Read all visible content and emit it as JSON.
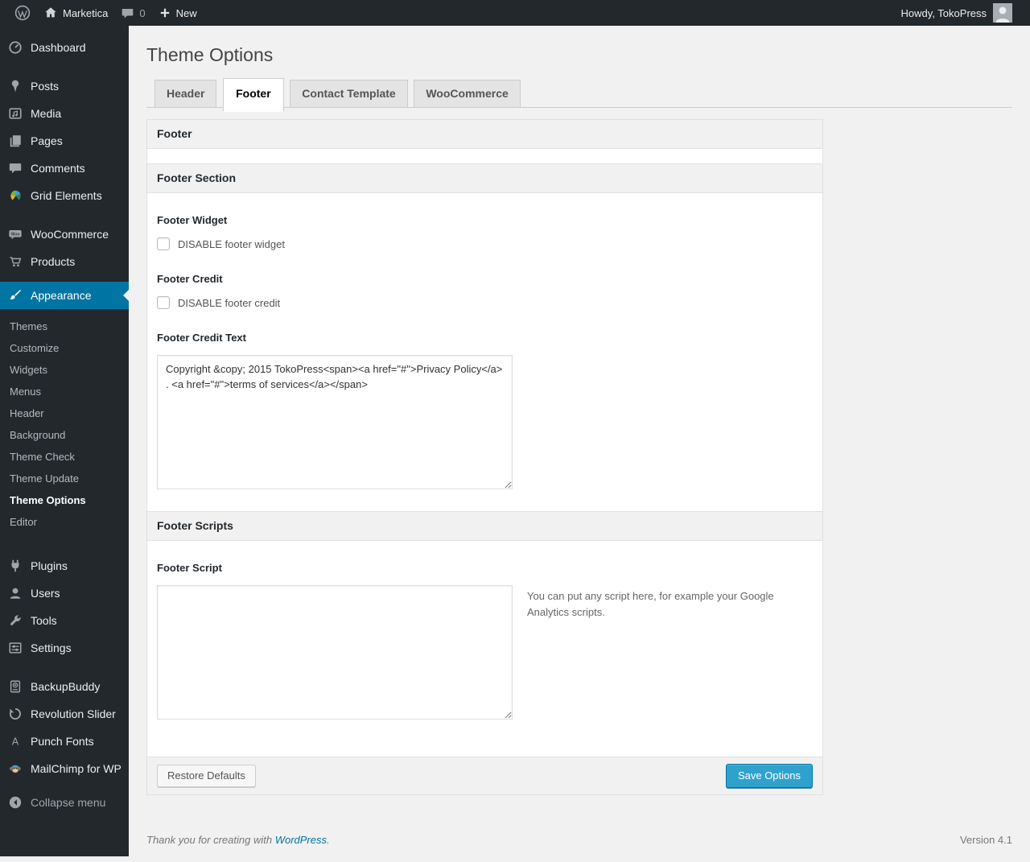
{
  "admin_bar": {
    "site_name": "Marketica",
    "comments_count": "0",
    "new_label": "New",
    "howdy": "Howdy, TokoPress"
  },
  "sidebar": {
    "items": [
      {
        "label": "Dashboard",
        "icon": "dashboard-icon"
      },
      {
        "label": "Posts",
        "icon": "pin-icon"
      },
      {
        "label": "Media",
        "icon": "media-icon"
      },
      {
        "label": "Pages",
        "icon": "pages-icon"
      },
      {
        "label": "Comments",
        "icon": "comment-bubble-icon"
      },
      {
        "label": "Grid Elements",
        "icon": "grid-elements-icon"
      },
      {
        "label": "WooCommerce",
        "icon": "woocommerce-badge-icon"
      },
      {
        "label": "Products",
        "icon": "cart-icon"
      },
      {
        "label": "Appearance",
        "icon": "paintbrush-icon",
        "active": true
      },
      {
        "label": "Plugins",
        "icon": "plug-icon"
      },
      {
        "label": "Users",
        "icon": "user-icon"
      },
      {
        "label": "Tools",
        "icon": "wrench-icon"
      },
      {
        "label": "Settings",
        "icon": "sliders-icon"
      },
      {
        "label": "BackupBuddy",
        "icon": "backup-drive-icon"
      },
      {
        "label": "Revolution Slider",
        "icon": "refresh-icon"
      },
      {
        "label": "Punch Fonts",
        "icon": "letter-a-icon"
      },
      {
        "label": "MailChimp for WP",
        "icon": "monkey-icon"
      }
    ],
    "appearance_submenu": {
      "items": [
        "Themes",
        "Customize",
        "Widgets",
        "Menus",
        "Header",
        "Background",
        "Theme Check",
        "Theme Update",
        "Theme Options",
        "Editor"
      ],
      "current": "Theme Options"
    },
    "collapse_label": "Collapse menu"
  },
  "main": {
    "page_title": "Theme Options",
    "tabs": [
      {
        "label": "Header",
        "active": false
      },
      {
        "label": "Footer",
        "active": true
      },
      {
        "label": "Contact Template",
        "active": false
      },
      {
        "label": "WooCommerce",
        "active": false
      }
    ],
    "footer_panel_title": "Footer",
    "footer_section": {
      "title": "Footer Section",
      "footer_widget_label": "Footer Widget",
      "footer_widget_checkbox_label": "DISABLE footer widget",
      "footer_widget_checked": false,
      "footer_credit_label": "Footer Credit",
      "footer_credit_checkbox_label": "DISABLE footer credit",
      "footer_credit_checked": false,
      "footer_credit_text_label": "Footer Credit Text",
      "footer_credit_text_value": "Copyright &copy; 2015 TokoPress<span><a href=\"#\">Privacy Policy</a> . <a href=\"#\">terms of services</a></span>"
    },
    "footer_scripts": {
      "title": "Footer Scripts",
      "footer_script_label": "Footer Script",
      "footer_script_value": "",
      "footer_script_help": "You can put any script here, for example your Google Analytics scripts."
    },
    "actions": {
      "restore_label": "Restore Defaults",
      "save_label": "Save Options"
    }
  },
  "page_footer": {
    "thanks_prefix": "Thank you for creating with ",
    "thanks_link": "WordPress",
    "thanks_suffix": ".",
    "version": "Version 4.1"
  },
  "colors": {
    "accent": "#0074a2",
    "primary_button": "#2ea2cc",
    "admin_dark": "#23282d",
    "page_background": "#f1f1f1"
  }
}
